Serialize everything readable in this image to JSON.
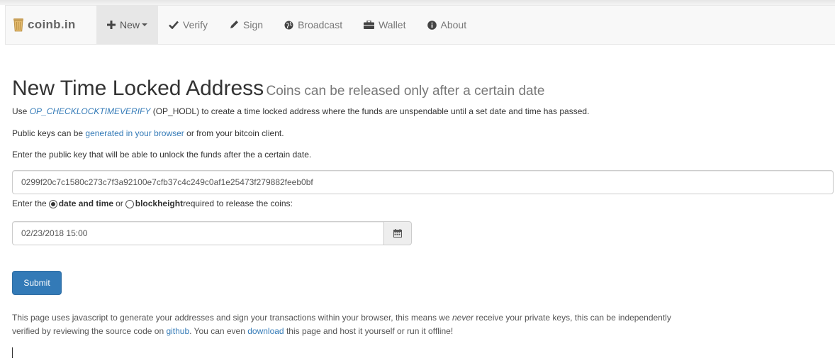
{
  "brand": {
    "name_part1": "coinb",
    "name_dot": ".",
    "name_part2": "in"
  },
  "nav": {
    "new": "New",
    "verify": "Verify",
    "sign": "Sign",
    "broadcast": "Broadcast",
    "wallet": "Wallet",
    "about": "About"
  },
  "page": {
    "title": "New Time Locked Address",
    "subtitle": "Coins can be released only after a certain date",
    "intro": {
      "prefix": "Use ",
      "opcode_link": "OP_CHECKLOCKTIMEVERIFY",
      "suffix": " (OP_HODL) to create a time locked address where the funds are unspendable until a set date and time has passed."
    },
    "pubkeys": {
      "prefix": "Public keys can be ",
      "link": "generated in your browser",
      "suffix": " or from your bitcoin client."
    },
    "enter_pubkey_label": "Enter the public key that will be able to unlock the funds after the a certain date.",
    "pubkey_value": "0299f20c7c1580c273c7f3a92100e7cfb37c4c249c0af1e25473f279882feeb0bf",
    "release": {
      "prefix": "Enter the ",
      "option_date": "date and time",
      "or": " or ",
      "option_block": "blockheight",
      "suffix": " required to release the coins:",
      "selected": "date and time"
    },
    "date_value": "02/23/2018 15:00",
    "submit": "Submit",
    "footer": {
      "l1_a": "This page uses javascript to generate your addresses and sign your transactions within your browser, this means we ",
      "l1_never": "never",
      "l1_b": " receive your private keys, this can be independently",
      "l2_a": "verified by reviewing the source code on ",
      "l2_github": "github",
      "l2_b": ". You can even ",
      "l2_download": "download",
      "l2_c": " this page and host it yourself or run it offline!"
    }
  },
  "colors": {
    "link": "#337ab7",
    "primary_button": "#337ab7",
    "navbar_bg": "#f8f8f8"
  },
  "icons": {
    "brand": "trash-can-icon",
    "new": "plus-icon",
    "verify": "checkmark-icon",
    "sign": "pencil-icon",
    "broadcast": "globe-icon",
    "wallet": "briefcase-icon",
    "about": "info-circle-icon",
    "date": "calendar-icon"
  }
}
